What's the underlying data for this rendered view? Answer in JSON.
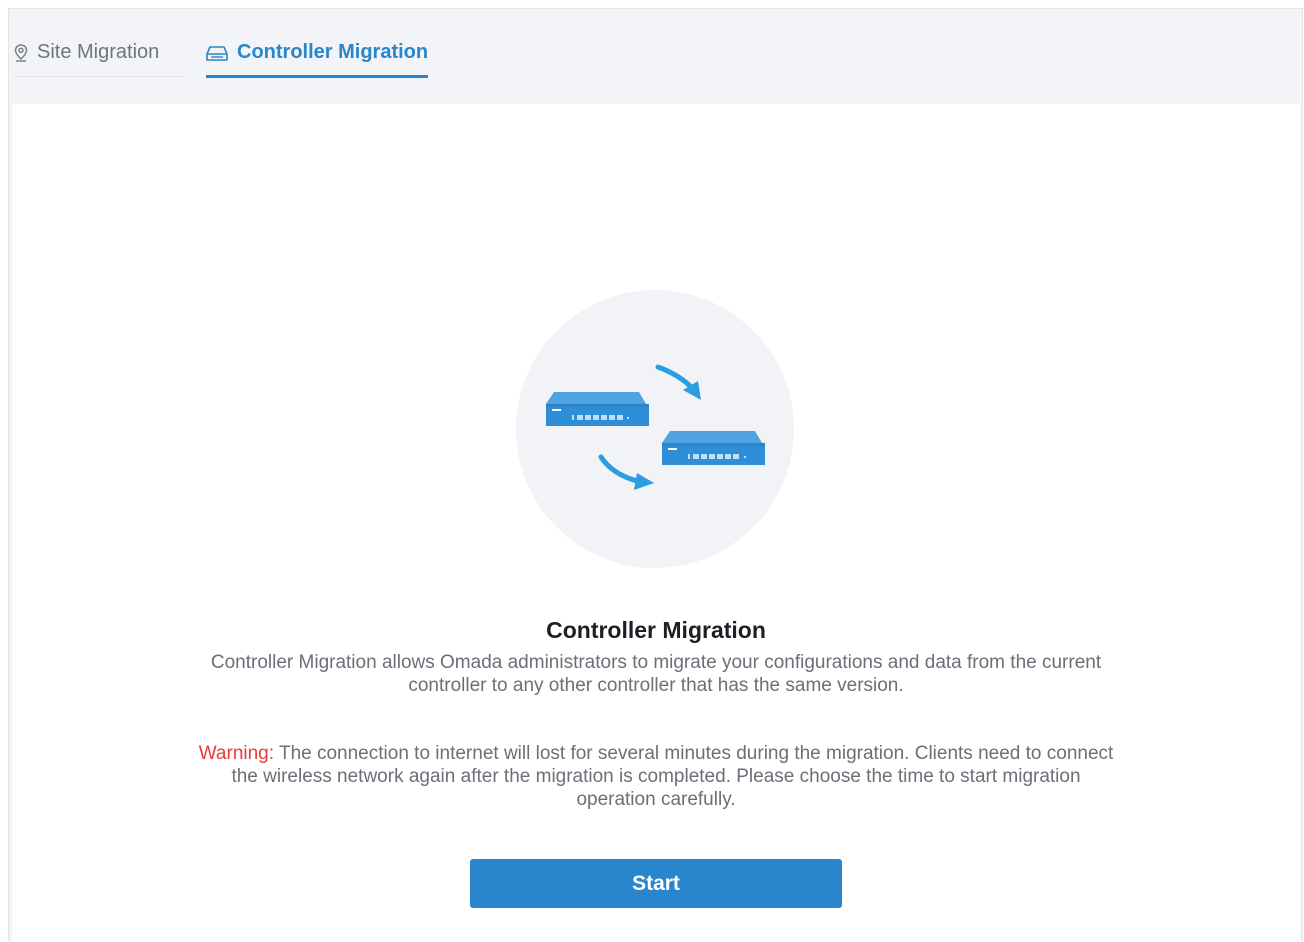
{
  "tabs": [
    {
      "label": "Site Migration",
      "icon": "location-pin-icon",
      "active": false
    },
    {
      "label": "Controller Migration",
      "icon": "controller-device-icon",
      "active": true
    }
  ],
  "main": {
    "illustration_icon": "controller-migration-illustration",
    "title": "Controller Migration",
    "description": "Controller Migration allows Omada administrators to migrate your configurations and data from the current controller to any other controller that has the same version.",
    "warning_label": "Warning:",
    "warning_text": " The connection to internet will lost for several minutes during the migration. Clients need to connect the wireless network again after the migration is completed. Please choose the time to start migration operation carefully.",
    "start_label": "Start"
  },
  "colors": {
    "accent": "#2a86cc",
    "warning": "#e83b3b",
    "text_muted": "#6a6f78",
    "background": "#f3f4f7"
  }
}
